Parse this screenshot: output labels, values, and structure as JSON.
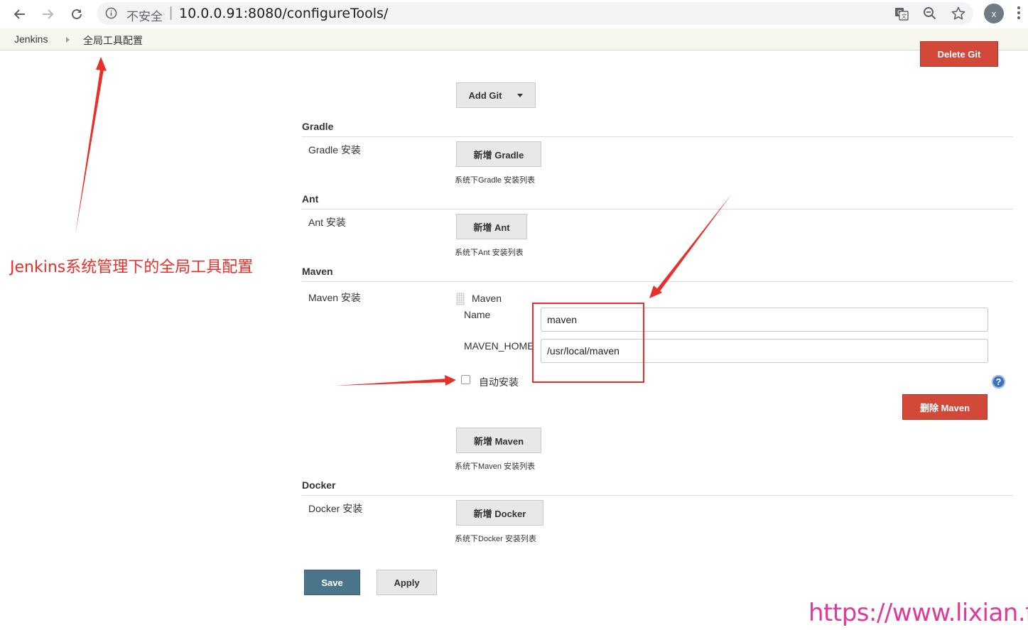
{
  "browser": {
    "insecure_label": "不安全",
    "url": "10.0.0.91:8080/configureTools/",
    "profile_initial": "x"
  },
  "breadcrumb": {
    "items": [
      "Jenkins",
      "全局工具配置"
    ]
  },
  "git": {
    "delete_label": "Delete Git",
    "add_label": "Add Git"
  },
  "gradle": {
    "title": "Gradle",
    "row_label": "Gradle 安装",
    "add_label": "新增 Gradle",
    "hint": "系统下Gradle 安装列表"
  },
  "ant": {
    "title": "Ant",
    "row_label": "Ant 安装",
    "add_label": "新增 Ant",
    "hint": "系统下Ant 安装列表"
  },
  "maven": {
    "title": "Maven",
    "row_label": "Maven 安装",
    "entry_header": "Maven",
    "name_label": "Name",
    "name_value": "maven",
    "home_label": "MAVEN_HOME",
    "home_value": "/usr/local/maven",
    "auto_install_label": "自动安装",
    "auto_install_checked": false,
    "delete_label": "删除 Maven",
    "add_label": "新增 Maven",
    "hint": "系统下Maven 安装列表"
  },
  "docker": {
    "title": "Docker",
    "row_label": "Docker 安装",
    "add_label": "新增 Docker",
    "hint": "系统下Docker 安装列表"
  },
  "actions": {
    "save_label": "Save",
    "apply_label": "Apply"
  },
  "annotation": {
    "text": "Jenkins系统管理下的全局工具配置",
    "color": "#e8302a"
  },
  "watermark": "https://www.lixian.fun",
  "colors": {
    "save_button": "#4b758b",
    "delete_button": "#d24939",
    "watermark": "#e0399b"
  }
}
